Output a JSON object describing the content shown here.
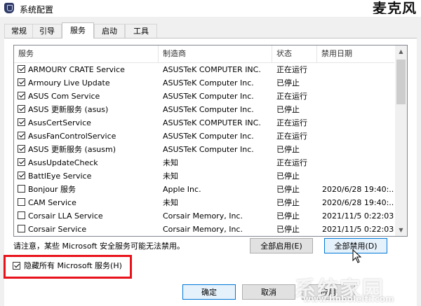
{
  "window": {
    "title": "系统配置",
    "title_right_partial": "麦克风"
  },
  "tabs": [
    {
      "label": "常规"
    },
    {
      "label": "引导"
    },
    {
      "label": "服务",
      "active": true
    },
    {
      "label": "启动"
    },
    {
      "label": "工具"
    }
  ],
  "table": {
    "columns": [
      "服务",
      "制造商",
      "状态",
      "禁用日期"
    ],
    "rows": [
      {
        "checked": true,
        "name": "ARMOURY CRATE Service",
        "manufacturer": "ASUSTeK COMPUTER INC.",
        "status": "正在运行",
        "disabled_date": ""
      },
      {
        "checked": true,
        "name": "Armoury Live Update",
        "manufacturer": "ASUSTeK Computer Inc.",
        "status": "已停止",
        "disabled_date": ""
      },
      {
        "checked": true,
        "name": "ASUS Com Service",
        "manufacturer": "ASUSTeK Computer Inc.",
        "status": "正在运行",
        "disabled_date": ""
      },
      {
        "checked": true,
        "name": "ASUS 更新服务 (asus)",
        "manufacturer": "ASUSTeK Computer Inc.",
        "status": "已停止",
        "disabled_date": ""
      },
      {
        "checked": true,
        "name": "AsusCertService",
        "manufacturer": "ASUSTeK COMPUTER INC.",
        "status": "正在运行",
        "disabled_date": ""
      },
      {
        "checked": true,
        "name": "AsusFanControlService",
        "manufacturer": "ASUSTeK Computer Inc.",
        "status": "正在运行",
        "disabled_date": ""
      },
      {
        "checked": true,
        "name": "ASUS 更新服务 (asusm)",
        "manufacturer": "ASUSTeK Computer Inc.",
        "status": "已停止",
        "disabled_date": ""
      },
      {
        "checked": true,
        "name": "AsusUpdateCheck",
        "manufacturer": "未知",
        "status": "正在运行",
        "disabled_date": ""
      },
      {
        "checked": true,
        "name": "BattlEye Service",
        "manufacturer": "未知",
        "status": "已停止",
        "disabled_date": ""
      },
      {
        "checked": false,
        "name": "Bonjour 服务",
        "manufacturer": "Apple Inc.",
        "status": "已停止",
        "disabled_date": "2020/6/28 19:40:..."
      },
      {
        "checked": false,
        "name": "CAM Service",
        "manufacturer": "未知",
        "status": "已停止",
        "disabled_date": "2020/6/28 19:40:..."
      },
      {
        "checked": false,
        "name": "Corsair LLA Service",
        "manufacturer": "Corsair Memory, Inc.",
        "status": "已停止",
        "disabled_date": "2021/11/5 0:22:03"
      },
      {
        "checked": false,
        "name": "Corsair Service",
        "manufacturer": "Corsair Memory, Inc.",
        "status": "已停止",
        "disabled_date": "2021/11/5 0:22:03"
      }
    ]
  },
  "notice": "请注意，某些 Microsoft 安全服务可能无法禁用。",
  "buttons": {
    "enable_all": "全部启用(E)",
    "disable_all": "全部禁用(D)",
    "ok": "确定",
    "cancel": "取消",
    "apply": "应用"
  },
  "hide_ms": {
    "label": "隐藏所有 Microsoft 服务(H)",
    "checked": true
  },
  "watermark": {
    "text": "系统家园",
    "url": "www.hnbolelti.com"
  },
  "colors": {
    "highlight": "#e8121b",
    "focus_border": "#0078d7"
  }
}
